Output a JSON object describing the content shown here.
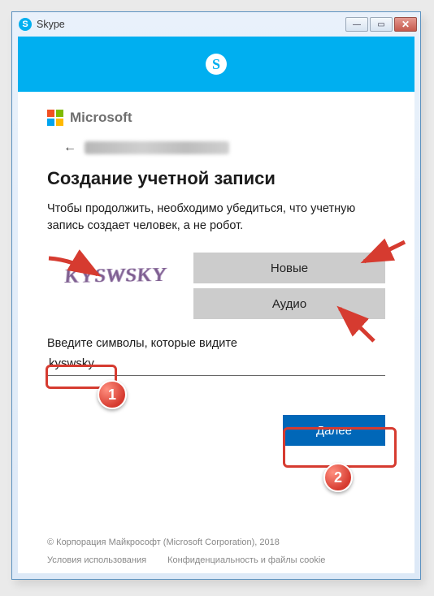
{
  "window": {
    "title": "Skype"
  },
  "header": {
    "ms_brand": "Microsoft",
    "identity_email": "obscured"
  },
  "page": {
    "title": "Создание учетной записи",
    "subtitle": "Чтобы продолжить, необходимо убедиться, что учетную запись создает человек, а не робот."
  },
  "captcha": {
    "image_text": "KYSWSKY",
    "btn_new": "Новые",
    "btn_audio": "Аудио",
    "input_label": "Введите символы, которые видите",
    "input_value": "kyswsky"
  },
  "action": {
    "next": "Далее"
  },
  "footer": {
    "copyright": "© Корпорация Майкрософт (Microsoft Corporation), 2018",
    "terms": "Условия использования",
    "privacy": "Конфиденциальность и файлы cookie"
  },
  "annotations": {
    "badge1": "1",
    "badge2": "2"
  }
}
